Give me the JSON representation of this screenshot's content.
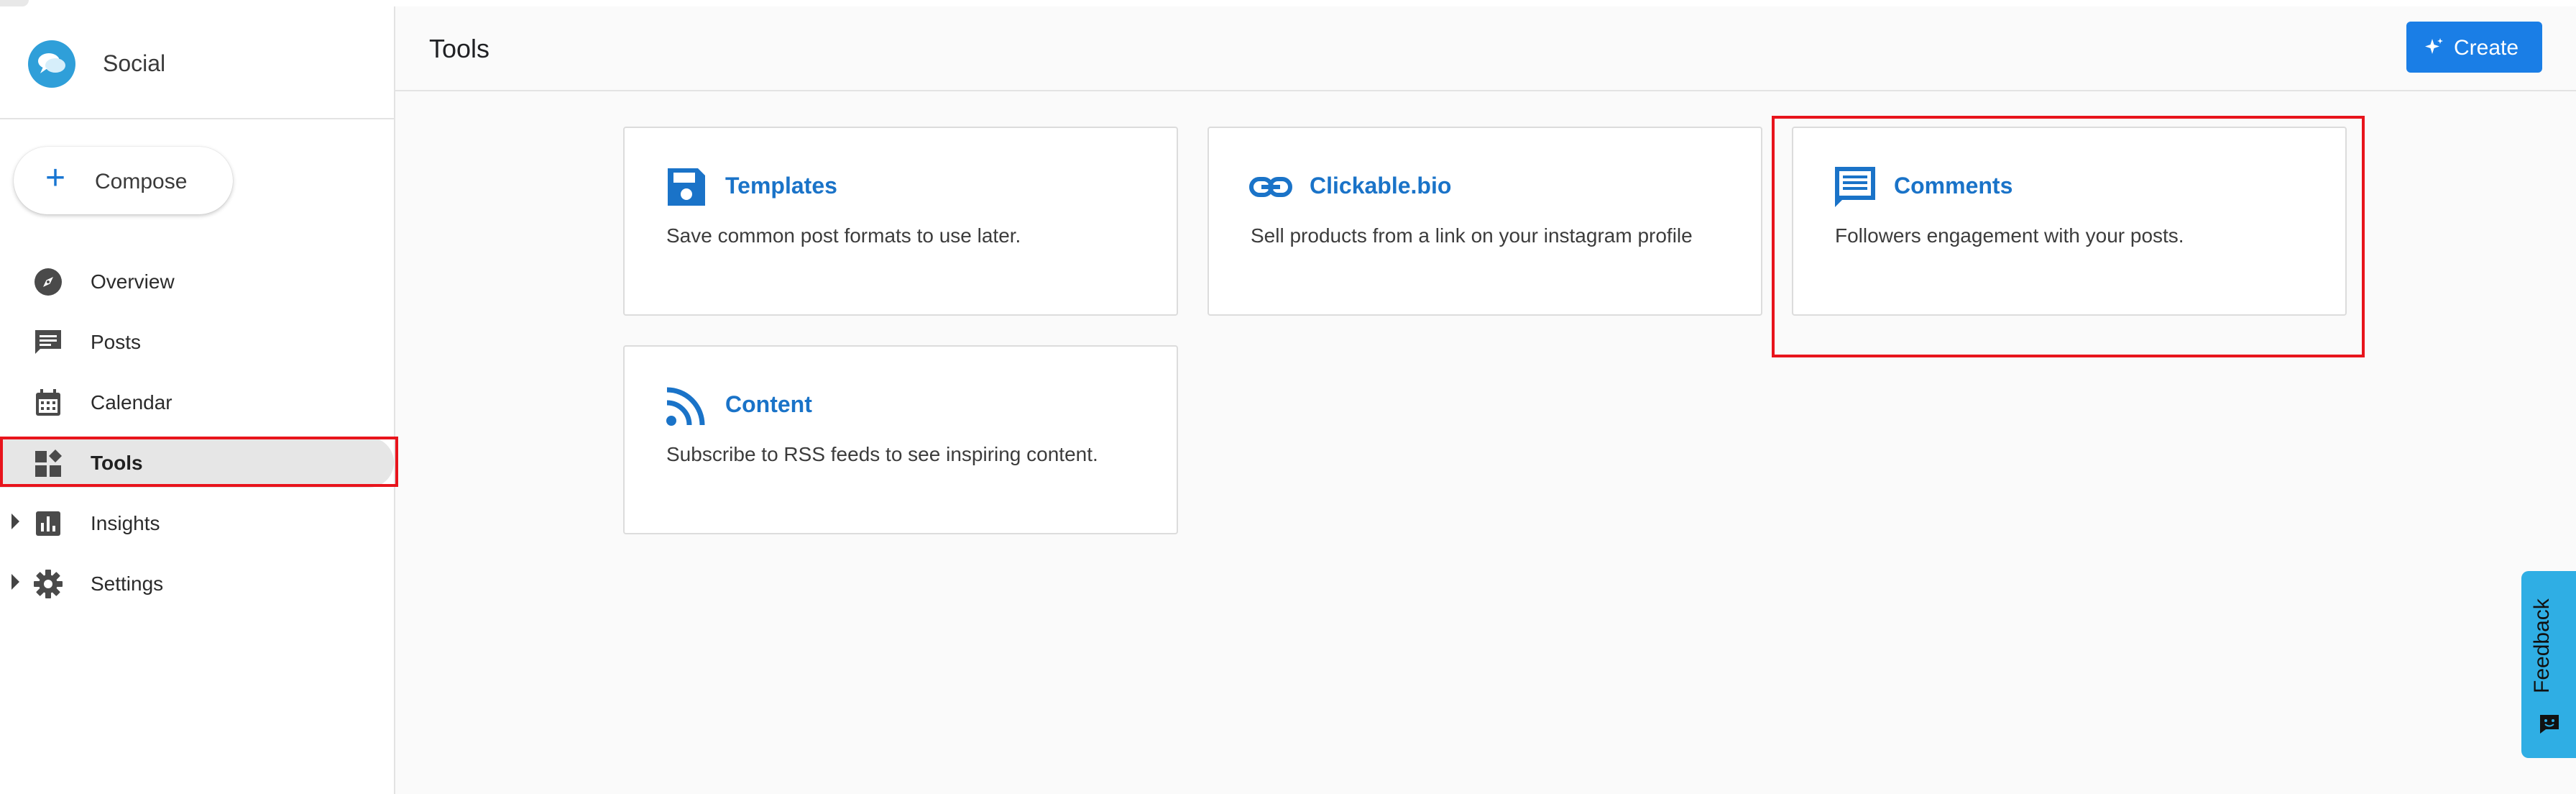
{
  "brand": {
    "name": "Social",
    "logo_icon": "chat-bubbles-icon",
    "logo_color": "#2f9fd9"
  },
  "compose": {
    "label": "Compose",
    "icon": "plus-icon"
  },
  "nav": {
    "items": [
      {
        "label": "Overview",
        "icon": "compass-icon",
        "active": false,
        "expandable": false
      },
      {
        "label": "Posts",
        "icon": "message-icon",
        "active": false,
        "expandable": false
      },
      {
        "label": "Calendar",
        "icon": "calendar-icon",
        "active": false,
        "expandable": false
      },
      {
        "label": "Tools",
        "icon": "widgets-icon",
        "active": true,
        "expandable": false
      },
      {
        "label": "Insights",
        "icon": "bar-chart-icon",
        "active": false,
        "expandable": true
      },
      {
        "label": "Settings",
        "icon": "gear-icon",
        "active": false,
        "expandable": true
      }
    ]
  },
  "header": {
    "title": "Tools",
    "create_label": "Create",
    "create_icon": "sparkle-icon"
  },
  "cards": [
    {
      "title": "Templates",
      "description": "Save common post formats to use later.",
      "icon": "save-icon"
    },
    {
      "title": "Clickable.bio",
      "description": "Sell products from a link on your instagram profile",
      "icon": "link-icon"
    },
    {
      "title": "Comments",
      "description": "Followers engagement with your posts.",
      "icon": "comment-icon"
    },
    {
      "title": "Content",
      "description": "Subscribe to RSS feeds to see inspiring content.",
      "icon": "rss-icon"
    }
  ],
  "feedback": {
    "label": "Feedback",
    "icon": "smile-chat-icon"
  },
  "colors": {
    "accent": "#1a7ee6",
    "link": "#1a73c8",
    "highlight": "#e8141c",
    "feedback": "#2faee4"
  }
}
